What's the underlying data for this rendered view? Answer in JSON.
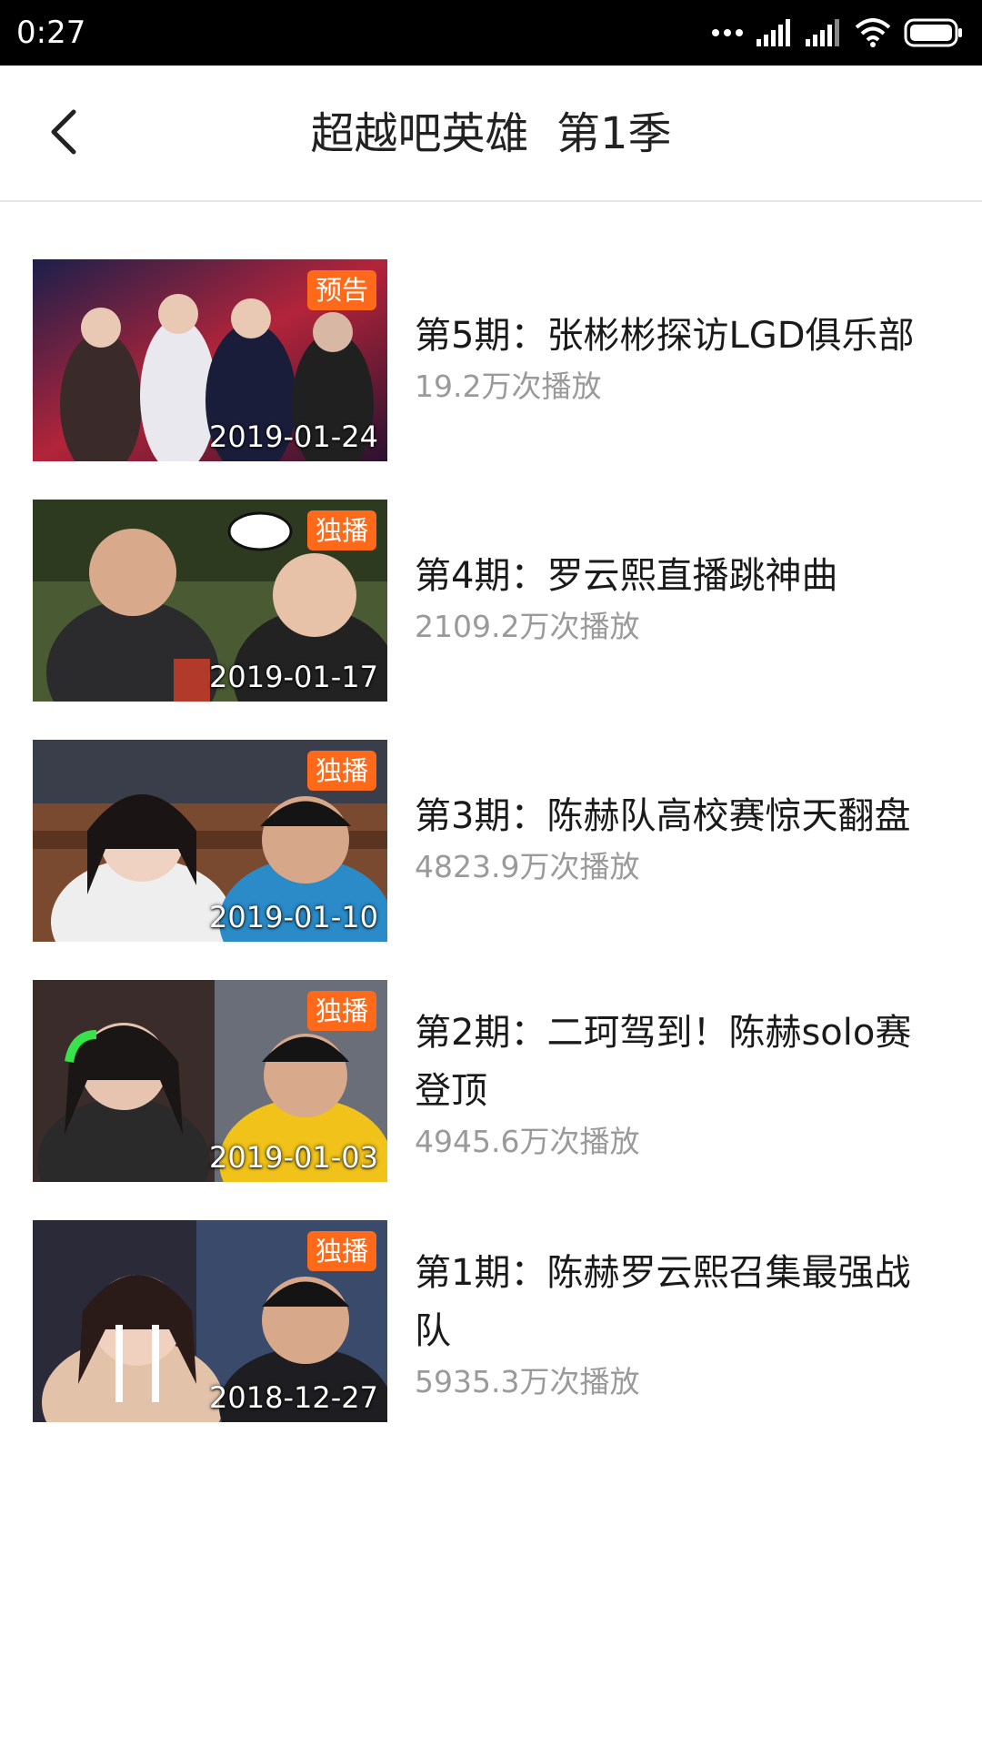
{
  "status_bar": {
    "time": "0:27",
    "icons": [
      "more-dots-icon",
      "signal-icon",
      "signal-icon",
      "wifi-icon",
      "battery-icon"
    ]
  },
  "header": {
    "title": "超越吧英雄  第1季",
    "back_icon": "chevron-left-icon"
  },
  "colors": {
    "badge": "#ff6a1a",
    "title_text": "#1a1a1a",
    "views_text": "#9a9a9a"
  },
  "episodes": [
    {
      "badge": "预告",
      "date": "2019-01-24",
      "title": "第5期：张彬彬探访LGD俱乐部",
      "views": "19.2万次播放"
    },
    {
      "badge": "独播",
      "date": "2019-01-17",
      "title": "第4期：罗云熙直播跳神曲",
      "views": "2109.2万次播放"
    },
    {
      "badge": "独播",
      "date": "2019-01-10",
      "title": "第3期：陈赫队高校赛惊天翻盘",
      "views": "4823.9万次播放"
    },
    {
      "badge": "独播",
      "date": "2019-01-03",
      "title": "第2期：二珂驾到！陈赫solo赛登顶",
      "views": "4945.6万次播放"
    },
    {
      "badge": "独播",
      "date": "2018-12-27",
      "title": "第1期：陈赫罗云熙召集最强战队",
      "views": "5935.3万次播放"
    }
  ]
}
